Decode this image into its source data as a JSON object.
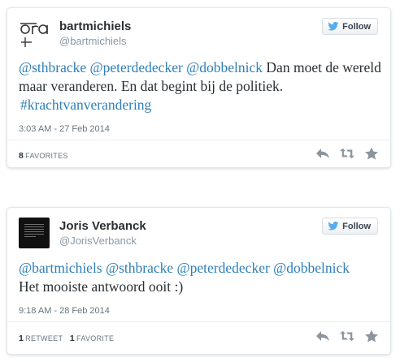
{
  "tweets": [
    {
      "user": {
        "name": "bartmichiels",
        "handle": "@bartmichiels"
      },
      "follow_label": "Follow",
      "text": {
        "mentions": [
          "@sthbracke",
          "@peterdedecker",
          "@dobbelnick"
        ],
        "body": "Dan moet de wereld maar veranderen. En dat begint bij de politiek.",
        "hashtag": "#krachtvanverandering"
      },
      "timestamp": "3:03 AM - 27 Feb 2014",
      "stats": {
        "favorites_count": "8",
        "favorites_label": "FAVORITES"
      },
      "actions": [
        "reply-icon",
        "retweet-icon",
        "favorite-icon"
      ]
    },
    {
      "user": {
        "name": "Joris Verbanck",
        "handle": "@JorisVerbanck"
      },
      "follow_label": "Follow",
      "text": {
        "mentions": [
          "@bartmichiels",
          "@sthbracke",
          "@peterdedecker",
          "@dobbelnick"
        ],
        "body": "Het mooiste antwoord ooit :)"
      },
      "timestamp": "9:18 AM - 28 Feb 2014",
      "stats": {
        "retweets_count": "1",
        "retweets_label": "RETWEET",
        "favorites_count": "1",
        "favorites_label": "FAVORITE"
      },
      "actions": [
        "reply-icon",
        "retweet-icon",
        "favorite-icon"
      ]
    }
  ],
  "colors": {
    "link": "#2e7fb8",
    "text": "#292f33",
    "muted": "#66757f",
    "handle": "#8899a6",
    "twitter_bird": "#55acee",
    "action_icon": "#8c959d"
  }
}
